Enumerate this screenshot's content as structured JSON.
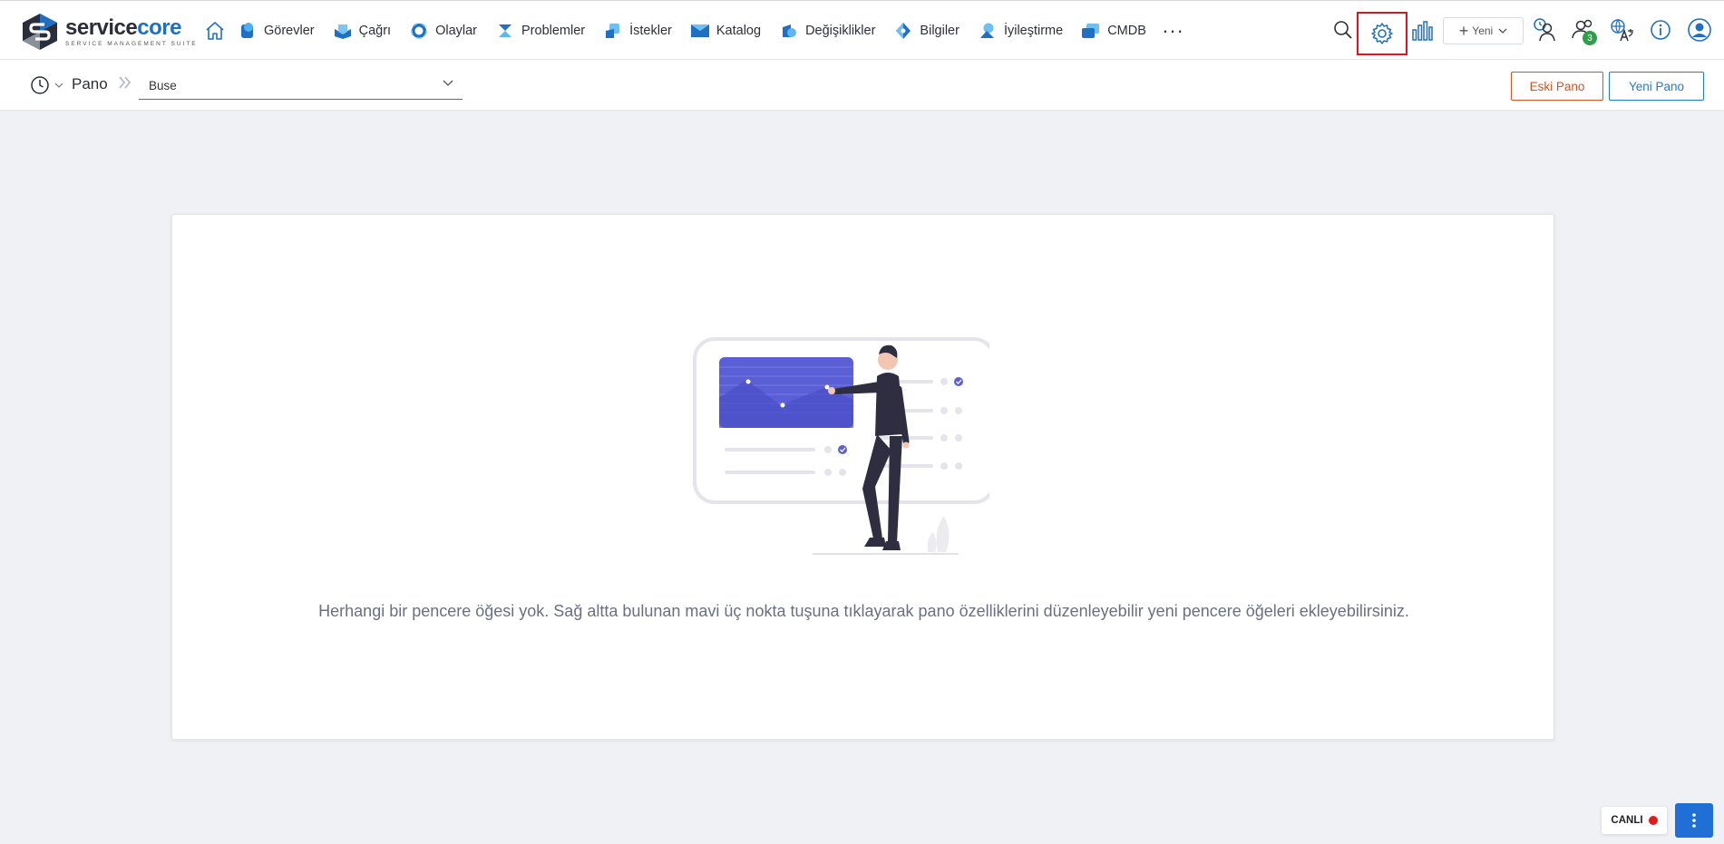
{
  "brand": {
    "name_part1": "service",
    "name_part2": "core",
    "tagline": "SERVICE MANAGEMENT SUITE"
  },
  "nav": {
    "items": [
      {
        "label": "Görevler",
        "icon": "tasks-icon"
      },
      {
        "label": "Çağrı",
        "icon": "call-icon"
      },
      {
        "label": "Olaylar",
        "icon": "incidents-icon"
      },
      {
        "label": "Problemler",
        "icon": "problems-icon"
      },
      {
        "label": "İstekler",
        "icon": "requests-icon"
      },
      {
        "label": "Katalog",
        "icon": "catalog-icon"
      },
      {
        "label": "Değişiklikler",
        "icon": "changes-icon"
      },
      {
        "label": "Bilgiler",
        "icon": "knowledge-icon"
      },
      {
        "label": "İyileştirme",
        "icon": "improvement-icon"
      },
      {
        "label": "CMDB",
        "icon": "cmdb-icon"
      }
    ],
    "more_label": "..."
  },
  "toolbar": {
    "new_label": "Yeni",
    "notifications_count": "3"
  },
  "subbar": {
    "breadcrumb_label": "Pano",
    "dashboard_selected": "Buse",
    "old_dashboard_label": "Eski Pano",
    "new_dashboard_label": "Yeni Pano"
  },
  "main": {
    "empty_message": "Herhangi bir pencere öğesi yok. Sağ altta bulunan mavi üç nokta tuşuna tıklayarak pano özelliklerini düzenleyebilir yeni pencere öğeleri ekleyebilirsiniz."
  },
  "footer": {
    "live_label": "CANLI"
  },
  "colors": {
    "accent": "#1f6fd6",
    "old_button": "#d4531f",
    "highlight": "#e0141e",
    "live_dot": "#e11a1a",
    "badge": "#2e9e4a"
  }
}
